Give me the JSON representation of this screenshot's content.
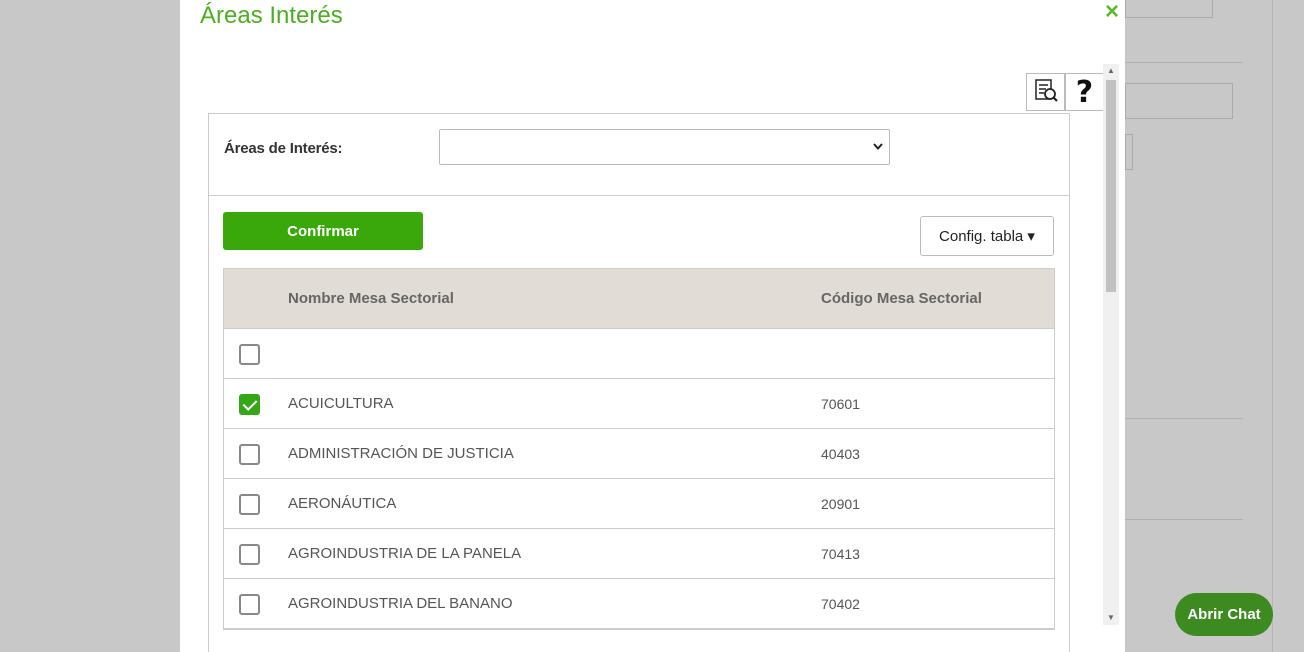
{
  "modal": {
    "title": "Áreas Interés",
    "close_label": "×",
    "tools": [
      {
        "icon": "report-search-icon"
      },
      {
        "icon": "help-icon",
        "label": "?"
      }
    ]
  },
  "filter": {
    "label": "Áreas de Interés:",
    "selected_value": ""
  },
  "actions": {
    "confirm_label": "Confirmar",
    "config_label": "Config. tabla ▾"
  },
  "table": {
    "columns": [
      "Nombre Mesa Sectorial",
      "Código Mesa Sectorial"
    ],
    "rows": [
      {
        "name": "",
        "code": "",
        "checked": false
      },
      {
        "name": "ACUICULTURA",
        "code": "70601",
        "checked": true
      },
      {
        "name": "ADMINISTRACIÓN DE JUSTICIA",
        "code": "40403",
        "checked": false
      },
      {
        "name": "AERONÁUTICA",
        "code": "20901",
        "checked": false
      },
      {
        "name": "AGROINDUSTRIA DE LA PANELA",
        "code": "70413",
        "checked": false
      },
      {
        "name": "AGROINDUSTRIA DEL BANANO",
        "code": "70402",
        "checked": false
      }
    ]
  },
  "chat": {
    "label": "Abrir Chat"
  },
  "colors": {
    "accent": "#3aa80a",
    "title": "#4caf22",
    "header_bg": "#e1ddd6",
    "chat_bg": "#3c8a20"
  }
}
